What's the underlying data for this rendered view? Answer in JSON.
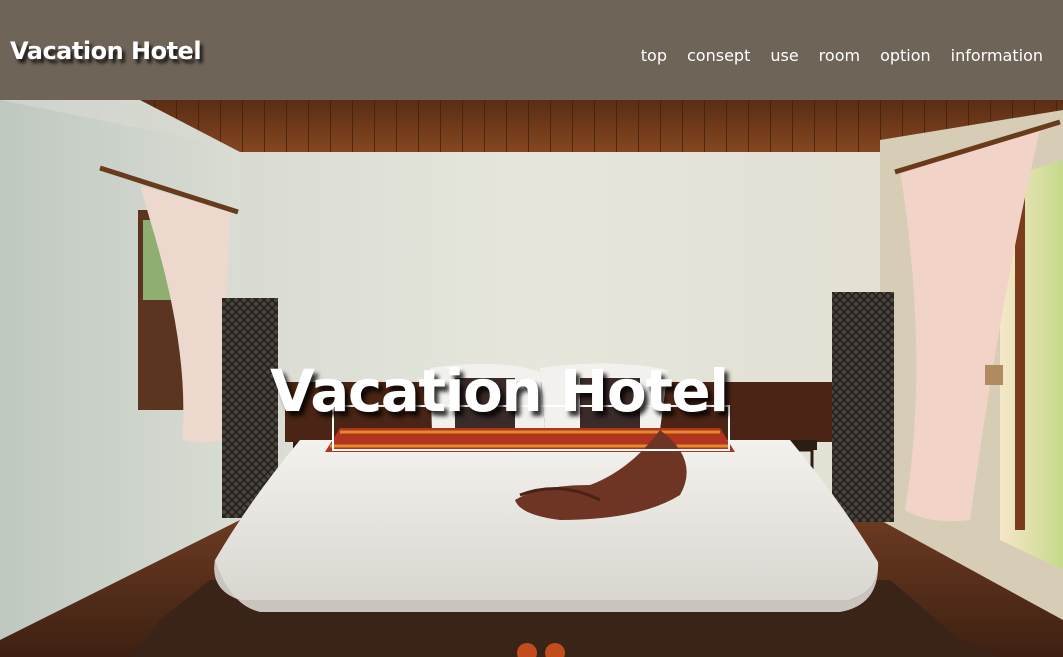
{
  "header": {
    "logo": "Vacation Hotel"
  },
  "nav": {
    "items": [
      {
        "label": "top"
      },
      {
        "label": "consept"
      },
      {
        "label": "use"
      },
      {
        "label": "room"
      },
      {
        "label": "option"
      },
      {
        "label": "information"
      }
    ]
  },
  "hero": {
    "title": "Vacation Hotel",
    "image_subject": "bedroom-photo"
  },
  "colors": {
    "header_bg": "#6e6458",
    "text": "#ffffff"
  }
}
